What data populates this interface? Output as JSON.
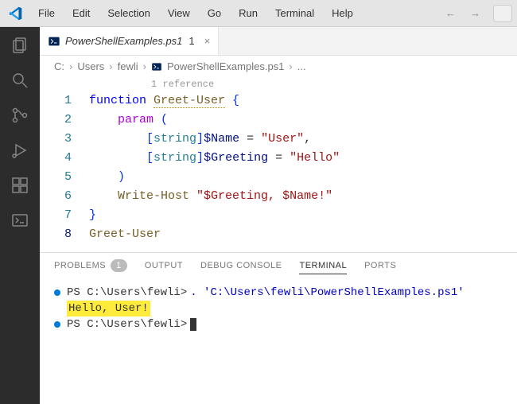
{
  "menubar": {
    "items": [
      "File",
      "Edit",
      "Selection",
      "View",
      "Go",
      "Run",
      "Terminal",
      "Help"
    ]
  },
  "tab": {
    "filename": "PowerShellExamples.ps1",
    "dirty_indicator": "1",
    "close_glyph": "×"
  },
  "breadcrumbs": {
    "parts": [
      "C:",
      "Users",
      "fewli",
      "PowerShellExamples.ps1",
      "..."
    ]
  },
  "codelens": {
    "references": "1 reference"
  },
  "code": {
    "lines": [
      {
        "n": "1",
        "tokens": [
          [
            "kw-blue",
            "function "
          ],
          [
            "fn-name",
            "Greet-User"
          ],
          [
            "plain",
            " "
          ],
          [
            "brace",
            "{"
          ]
        ]
      },
      {
        "n": "2",
        "tokens": [
          [
            "plain",
            "    "
          ],
          [
            "param-kw",
            "param"
          ],
          [
            "plain",
            " "
          ],
          [
            "brace",
            "("
          ]
        ]
      },
      {
        "n": "3",
        "tokens": [
          [
            "plain",
            "        "
          ],
          [
            "brace",
            "["
          ],
          [
            "type",
            "string"
          ],
          [
            "brace",
            "]"
          ],
          [
            "var",
            "$Name"
          ],
          [
            "plain",
            " = "
          ],
          [
            "str",
            "\"User\""
          ],
          [
            "plain",
            ","
          ]
        ]
      },
      {
        "n": "4",
        "tokens": [
          [
            "plain",
            "        "
          ],
          [
            "brace",
            "["
          ],
          [
            "type",
            "string"
          ],
          [
            "brace",
            "]"
          ],
          [
            "var",
            "$Greeting"
          ],
          [
            "plain",
            " = "
          ],
          [
            "str",
            "\"Hello\""
          ]
        ]
      },
      {
        "n": "5",
        "tokens": [
          [
            "plain",
            "    "
          ],
          [
            "brace",
            ")"
          ]
        ]
      },
      {
        "n": "6",
        "tokens": [
          [
            "plain",
            "    "
          ],
          [
            "cmdlet",
            "Write-Host"
          ],
          [
            "plain",
            " "
          ],
          [
            "str",
            "\"$Greeting, $Name!\""
          ]
        ]
      },
      {
        "n": "7",
        "tokens": [
          [
            "brace",
            "}"
          ]
        ]
      },
      {
        "n": "8",
        "tokens": [
          [
            "cmdlet",
            "Greet-User"
          ]
        ]
      }
    ]
  },
  "panel": {
    "tabs": {
      "problems": "PROBLEMS",
      "problems_count": "1",
      "output": "OUTPUT",
      "debug": "DEBUG CONSOLE",
      "terminal": "TERMINAL",
      "ports": "PORTS"
    }
  },
  "terminal": {
    "prompt1": "PS C:\\Users\\fewli>",
    "command1": ". 'C:\\Users\\fewli\\PowerShellExamples.ps1'",
    "output1": "Hello, User!",
    "prompt2": "PS C:\\Users\\fewli>"
  }
}
